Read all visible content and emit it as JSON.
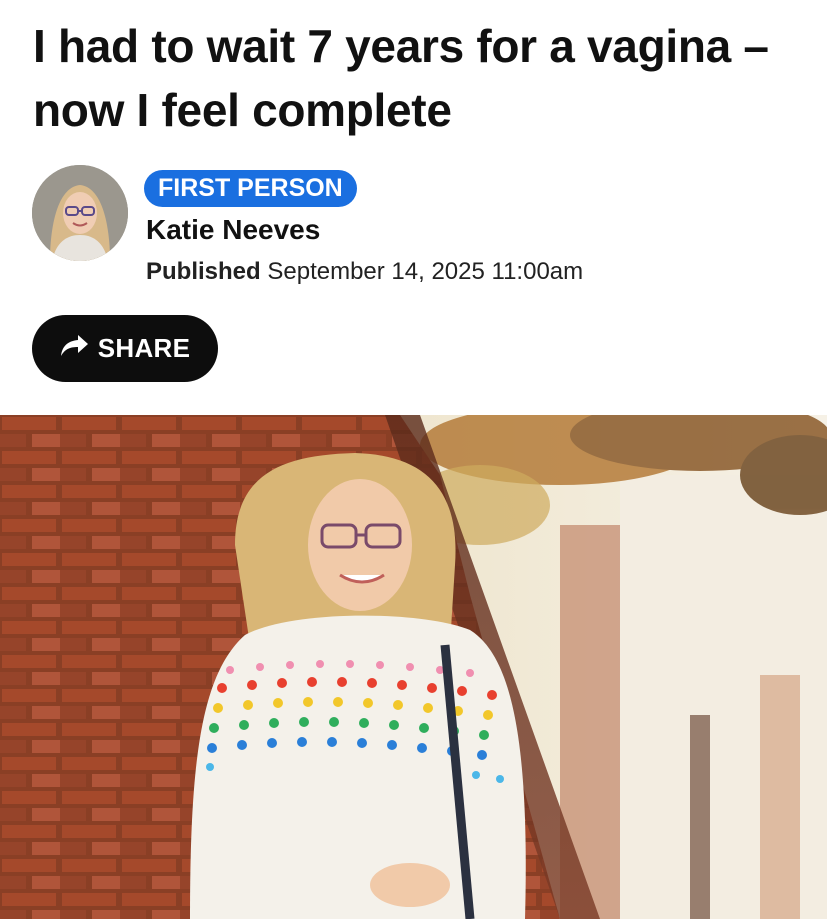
{
  "article": {
    "headline": "I had to wait 7 years for a vagina – now I feel complete",
    "category": "FIRST PERSON",
    "author": "Katie Neeves",
    "published_label": "Published",
    "published_date": "September 14, 2025 11:00am",
    "share_label": "SHARE"
  },
  "icons": {
    "share": "share-arrow-icon"
  },
  "colors": {
    "category_badge": "#1a6fe0",
    "share_button": "#0d0d0d",
    "text": "#111111"
  }
}
